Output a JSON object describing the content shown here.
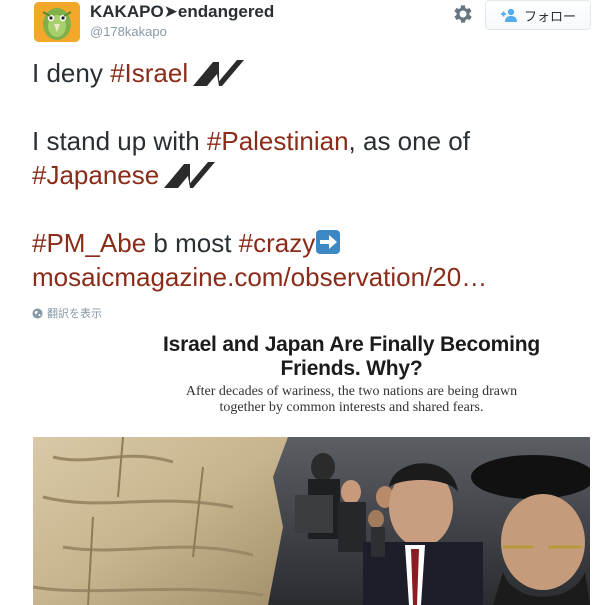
{
  "user": {
    "name": "KAKAPO➤endangered",
    "handle": "@178kakapo"
  },
  "actions": {
    "follow_label": "フォロー"
  },
  "tweet": {
    "line1": {
      "text": "I deny ",
      "hashtag": "#Israel"
    },
    "line2": {
      "text_before": "I stand up with ",
      "hashtag": "#Palestinian",
      "text_after": ", as one of"
    },
    "line3": {
      "hashtag": "#Japanese"
    },
    "line4": {
      "hashtag1": "#PM_Abe",
      "text_middle": " b most ",
      "hashtag2": "#crazy"
    },
    "link": "mosaicmagazine.com/observation/20…",
    "translate_label": "翻訳を表示"
  },
  "card": {
    "title_line1": "Israel and Japan Are Finally Becoming",
    "title_line2": "Friends. Why?",
    "subtitle_line1": "After decades of wariness, the two nations are being drawn",
    "subtitle_line2": "together by common interests and shared fears."
  },
  "colors": {
    "hashtag": "#8b2b19",
    "avatar_bg": "#f4a82a",
    "handle": "#8899a6"
  }
}
